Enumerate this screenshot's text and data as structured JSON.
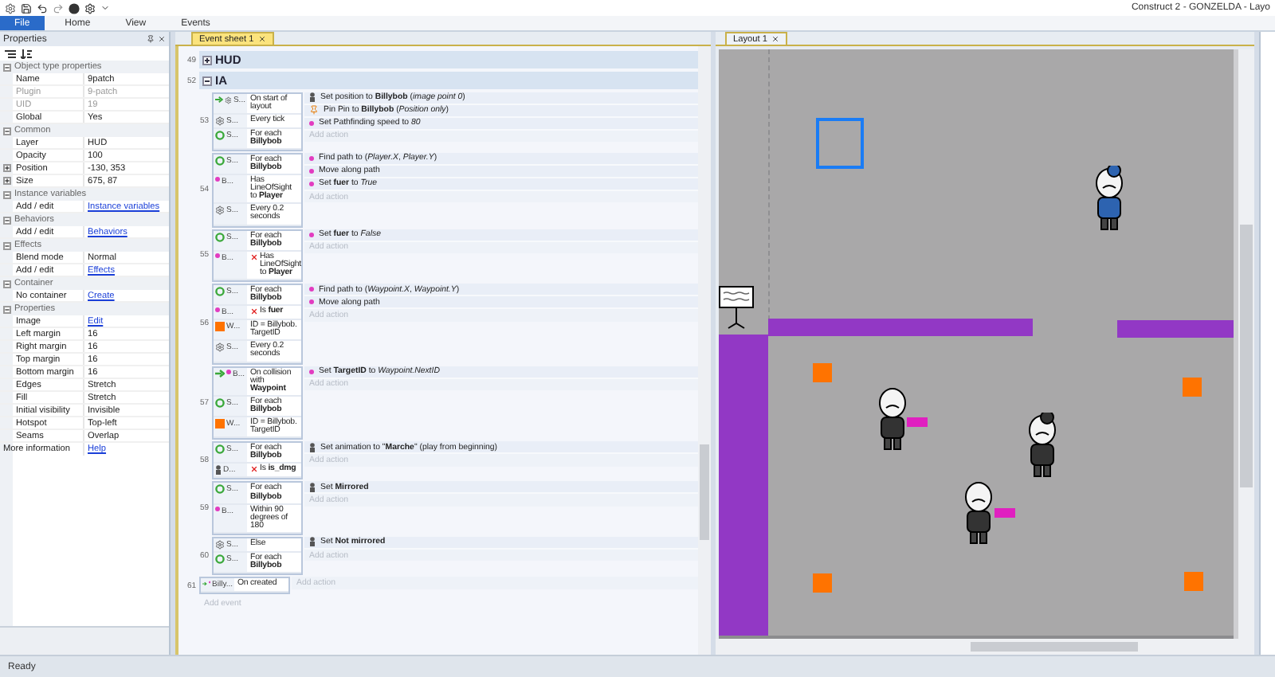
{
  "window": {
    "title": "Construct 2 - GONZELDA - Layo"
  },
  "ribbon_tabs": [
    {
      "label": "File",
      "selected": true
    },
    {
      "label": "Home",
      "selected": false
    },
    {
      "label": "View",
      "selected": false
    },
    {
      "label": "Events",
      "selected": false
    }
  ],
  "properties_panel": {
    "title": "Properties",
    "sections": [
      {
        "title": "Object type properties",
        "expanded": true,
        "rows": [
          {
            "name": "Name",
            "value": "9patch",
            "kind": "text"
          },
          {
            "name": "Plugin",
            "value": "9-patch",
            "kind": "disabled"
          },
          {
            "name": "UID",
            "value": "19",
            "kind": "disabled"
          },
          {
            "name": "Global",
            "value": "Yes",
            "kind": "text"
          }
        ]
      },
      {
        "title": "Common",
        "expanded": true,
        "rows": [
          {
            "name": "Layer",
            "value": "HUD",
            "kind": "text"
          },
          {
            "name": "Opacity",
            "value": "100",
            "kind": "text"
          },
          {
            "name": "Position",
            "value": "-130, 353",
            "kind": "composite"
          },
          {
            "name": "Size",
            "value": "675, 87",
            "kind": "composite"
          }
        ]
      },
      {
        "title": "Instance variables",
        "expanded": true,
        "rows": [
          {
            "name": "Add / edit",
            "value": "Instance variables",
            "kind": "link"
          }
        ]
      },
      {
        "title": "Behaviors",
        "expanded": true,
        "rows": [
          {
            "name": "Add / edit",
            "value": "Behaviors",
            "kind": "link"
          }
        ]
      },
      {
        "title": "Effects",
        "expanded": true,
        "rows": [
          {
            "name": "Blend mode",
            "value": "Normal",
            "kind": "text"
          },
          {
            "name": "Add / edit",
            "value": "Effects",
            "kind": "link"
          }
        ]
      },
      {
        "title": "Container",
        "expanded": true,
        "rows": [
          {
            "name": "No container",
            "value": "Create",
            "kind": "link"
          }
        ]
      },
      {
        "title": "Properties",
        "expanded": true,
        "rows": [
          {
            "name": "Image",
            "value": "Edit",
            "kind": "link"
          },
          {
            "name": "Left margin",
            "value": "16",
            "kind": "text"
          },
          {
            "name": "Right margin",
            "value": "16",
            "kind": "text"
          },
          {
            "name": "Top margin",
            "value": "16",
            "kind": "text"
          },
          {
            "name": "Bottom margin",
            "value": "16",
            "kind": "text"
          },
          {
            "name": "Edges",
            "value": "Stretch",
            "kind": "text"
          },
          {
            "name": "Fill",
            "value": "Stretch",
            "kind": "text"
          },
          {
            "name": "Initial visibility",
            "value": "Invisible",
            "kind": "text"
          },
          {
            "name": "Hotspot",
            "value": "Top-left",
            "kind": "text"
          },
          {
            "name": "Seams",
            "value": "Overlap",
            "kind": "text"
          }
        ]
      }
    ],
    "more_info": {
      "name": "More information",
      "value": "Help"
    }
  },
  "event_sheet": {
    "tab": "Event sheet 1",
    "rows": [
      {
        "number": "49",
        "kind": "group",
        "title": "HUD",
        "expanded": false
      },
      {
        "number": "52",
        "kind": "group",
        "title": "IA",
        "expanded": true,
        "children": [
          {
            "number": "53",
            "kind": "event",
            "add_action": "Add action",
            "conditions": [
              {
                "kind": "system",
                "trigger": true,
                "object": "S...",
                "text": "On start of layout",
                "inverted": false
              },
              {
                "kind": "system",
                "trigger": false,
                "object": "S...",
                "text": "Every tick",
                "inverted": false
              },
              {
                "kind": "loop",
                "trigger": false,
                "object": "S...",
                "text": "For each **Billybob**",
                "inverted": false
              }
            ],
            "actions": [
              {
                "kind": "sprite",
                "text": "Set position to **Billybob** (*image point 0*)"
              },
              {
                "kind": "pin",
                "text": "Pin Pin to **Billybob** (*Position only*)"
              },
              {
                "kind": "behavior",
                "text": "Set Pathfinding speed to *80*"
              }
            ]
          },
          {
            "number": "54",
            "kind": "event",
            "add_action": "Add action",
            "conditions": [
              {
                "kind": "loop",
                "trigger": false,
                "object": "S...",
                "text": "For each **Billybob**",
                "inverted": false
              },
              {
                "kind": "behavior",
                "trigger": false,
                "object": "B...",
                "text": "Has LineOfSight to **Player**",
                "inverted": false
              },
              {
                "kind": "system",
                "trigger": false,
                "object": "S...",
                "text": "Every 0.2 seconds",
                "inverted": false
              }
            ],
            "actions": [
              {
                "kind": "behavior",
                "text": "Find path to (*Player.X*, *Player.Y*)"
              },
              {
                "kind": "behavior",
                "text": "Move along path"
              },
              {
                "kind": "behavior",
                "text": "Set **fuer** to *True*"
              }
            ]
          },
          {
            "number": "55",
            "kind": "event",
            "add_action": "Add action",
            "conditions": [
              {
                "kind": "loop",
                "trigger": false,
                "object": "S...",
                "text": "For each **Billybob**",
                "inverted": false
              },
              {
                "kind": "behavior",
                "trigger": false,
                "object": "B...",
                "text": "Has LineOfSight to **Player**",
                "inverted": true
              }
            ],
            "actions": [
              {
                "kind": "behavior",
                "text": "Set **fuer** to *False*"
              }
            ]
          },
          {
            "number": "56",
            "kind": "event",
            "add_action": "Add action",
            "conditions": [
              {
                "kind": "loop",
                "trigger": false,
                "object": "S...",
                "text": "For each **Billybob**",
                "inverted": false
              },
              {
                "kind": "behavior",
                "trigger": false,
                "object": "B...",
                "text": "Is **fuer**",
                "inverted": true
              },
              {
                "kind": "waypoint",
                "trigger": false,
                "object": "W...",
                "text": "ID = Billybob. TargetID",
                "inverted": false
              },
              {
                "kind": "system",
                "trigger": false,
                "object": "S...",
                "text": "Every 0.2 seconds",
                "inverted": false
              }
            ],
            "actions": [
              {
                "kind": "behavior",
                "text": "Find path to (*Waypoint.X*, *Waypoint.Y*)"
              },
              {
                "kind": "behavior",
                "text": "Move along path"
              }
            ]
          },
          {
            "number": "57",
            "kind": "event",
            "add_action": "Add action",
            "conditions": [
              {
                "kind": "behavior",
                "trigger": true,
                "object": "B...",
                "text": "On collision with **Waypoint**",
                "inverted": false
              },
              {
                "kind": "loop",
                "trigger": false,
                "object": "S...",
                "text": "For each **Billybob**",
                "inverted": false
              },
              {
                "kind": "waypoint",
                "trigger": false,
                "object": "W...",
                "text": "ID = Billybob. TargetID",
                "inverted": false
              }
            ],
            "actions": [
              {
                "kind": "behavior",
                "text": "Set **TargetID** to *Waypoint.NextID*"
              }
            ]
          },
          {
            "number": "58",
            "kind": "event",
            "add_action": "Add action",
            "conditions": [
              {
                "kind": "loop",
                "trigger": false,
                "object": "S...",
                "text": "For each **Billybob**",
                "inverted": false
              },
              {
                "kind": "sprite",
                "trigger": false,
                "object": "D...",
                "text": "Is **is_dmg**",
                "inverted": true
              }
            ],
            "actions": [
              {
                "kind": "sprite",
                "text": "Set animation to \"**Marche**\" (play from beginning)"
              }
            ]
          },
          {
            "number": "59",
            "kind": "event",
            "add_action": "Add action",
            "conditions": [
              {
                "kind": "loop",
                "trigger": false,
                "object": "S...",
                "text": "For each **Billybob**",
                "inverted": false
              },
              {
                "kind": "behavior",
                "trigger": false,
                "object": "B...",
                "text": "Within 90 degrees of 180",
                "inverted": false
              }
            ],
            "actions": [
              {
                "kind": "sprite",
                "text": "Set **Mirrored**"
              }
            ]
          },
          {
            "number": "60",
            "kind": "event",
            "add_action": "Add action",
            "conditions": [
              {
                "kind": "system",
                "trigger": false,
                "object": "S...",
                "text": "Else",
                "inverted": false
              },
              {
                "kind": "loop",
                "trigger": false,
                "object": "S...",
                "text": "For each **Billybob**",
                "inverted": false
              }
            ],
            "actions": [
              {
                "kind": "sprite",
                "text": "Set **Not mirrored**"
              }
            ]
          }
        ]
      },
      {
        "number": "61",
        "kind": "event",
        "add_action": "Add action",
        "conditions": [
          {
            "kind": "behavior",
            "trigger": true,
            "object": "Billy...",
            "text": "On created",
            "inverted": false
          }
        ],
        "actions": []
      }
    ],
    "add_event": "Add event"
  },
  "layout": {
    "tab": "Layout 1"
  },
  "status_bar": "Ready"
}
